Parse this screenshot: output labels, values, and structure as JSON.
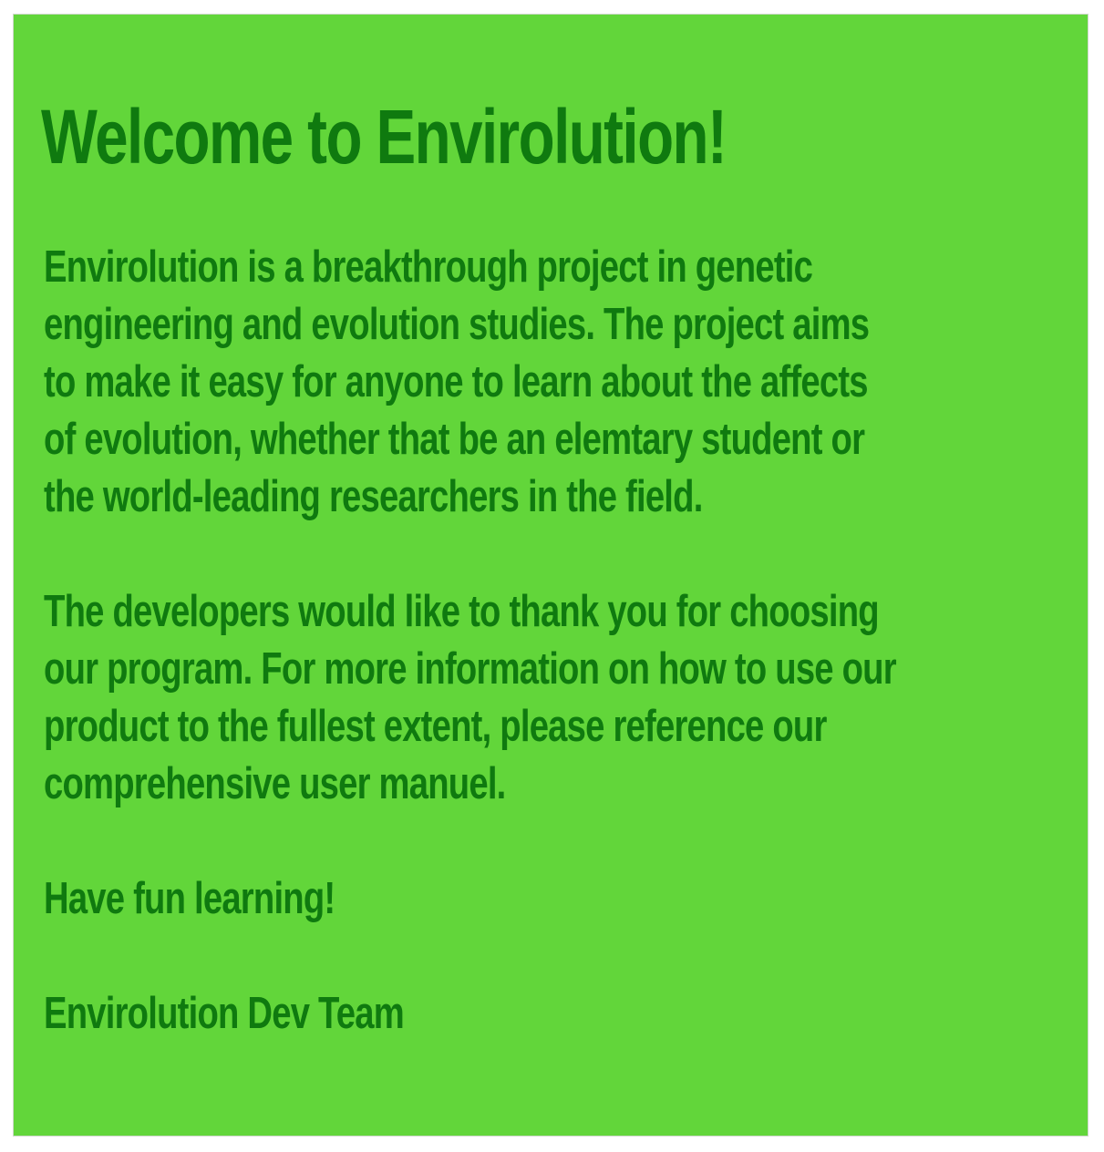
{
  "welcome": {
    "title": "Welcome to Envirolution!",
    "paragraph_1": "Envirolution is a breakthrough project in genetic\nengineering and evolution studies. The project aims\nto make it easy for anyone to learn about the affects\nof evolution, whether that be an elemtary student or\nthe world-leading researchers in the field.",
    "paragraph_2": "The developers would like to thank you for choosing\nour program. For more information on how to use our\nproduct to the fullest extent, please reference our\ncomprehensive user manuel.",
    "closing": "Have fun learning!",
    "signature": "Envirolution Dev Team"
  },
  "colors": {
    "panel_background": "#62d63a",
    "text": "#0f7a0f",
    "page_background": "#ffffff"
  }
}
